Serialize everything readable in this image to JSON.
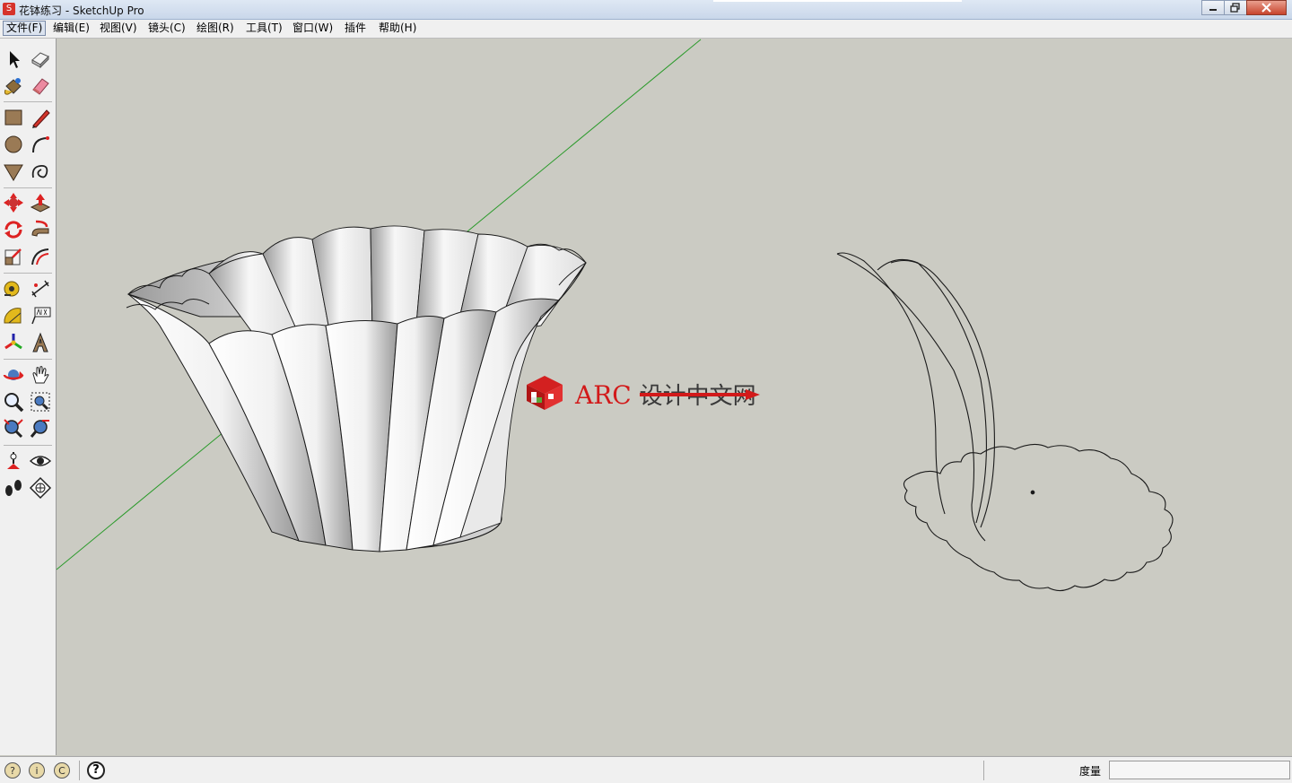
{
  "window": {
    "title": "花钵练习 - SketchUp Pro",
    "app_icon": "sketchup-logo-icon",
    "controls": {
      "minimize": "minimize-icon",
      "maximize": "restore-icon",
      "close": "close-icon"
    }
  },
  "menu": {
    "items": [
      "文件(F)",
      "编辑(E)",
      "视图(V)",
      "镜头(C)",
      "绘图(R)",
      "工具(T)",
      "窗口(W)",
      "插件",
      "帮助(H)"
    ],
    "active_index": 0
  },
  "toolbar": {
    "tools": [
      "select-arrow-icon",
      "make-component-icon",
      "paint-bucket-icon",
      "eraser-icon",
      "rectangle-icon",
      "pencil-line-icon",
      "circle-icon",
      "arc-icon",
      "polygon-icon",
      "freehand-icon",
      "move-icon",
      "push-pull-icon",
      "rotate-icon",
      "follow-me-icon",
      "scale-icon",
      "offset-icon",
      "tape-measure-icon",
      "dimension-icon",
      "protractor-icon",
      "text-label-icon",
      "axes-icon",
      "3d-text-icon",
      "orbit-icon",
      "pan-hand-icon",
      "zoom-icon",
      "zoom-window-icon",
      "zoom-extents-icon",
      "previous-view-icon",
      "position-camera-icon",
      "look-around-icon",
      "walk-icon",
      "section-plane-icon"
    ]
  },
  "watermark": {
    "latin": "ARC",
    "chinese": "设计中文网",
    "logo": "arc-cube-logo-icon"
  },
  "colors": {
    "viewport_bg": "#cbcbc3",
    "axis_green": "#2a9a2a",
    "watermark_red": "#d21a1a",
    "model_edge": "#1a1a1a"
  },
  "status": {
    "icons": [
      "geolocation-icon",
      "credits-icon",
      "login-icon"
    ],
    "help_glyph": "?",
    "help_icon": "help-icon",
    "measurement_label": "度量",
    "measurement_value": ""
  }
}
